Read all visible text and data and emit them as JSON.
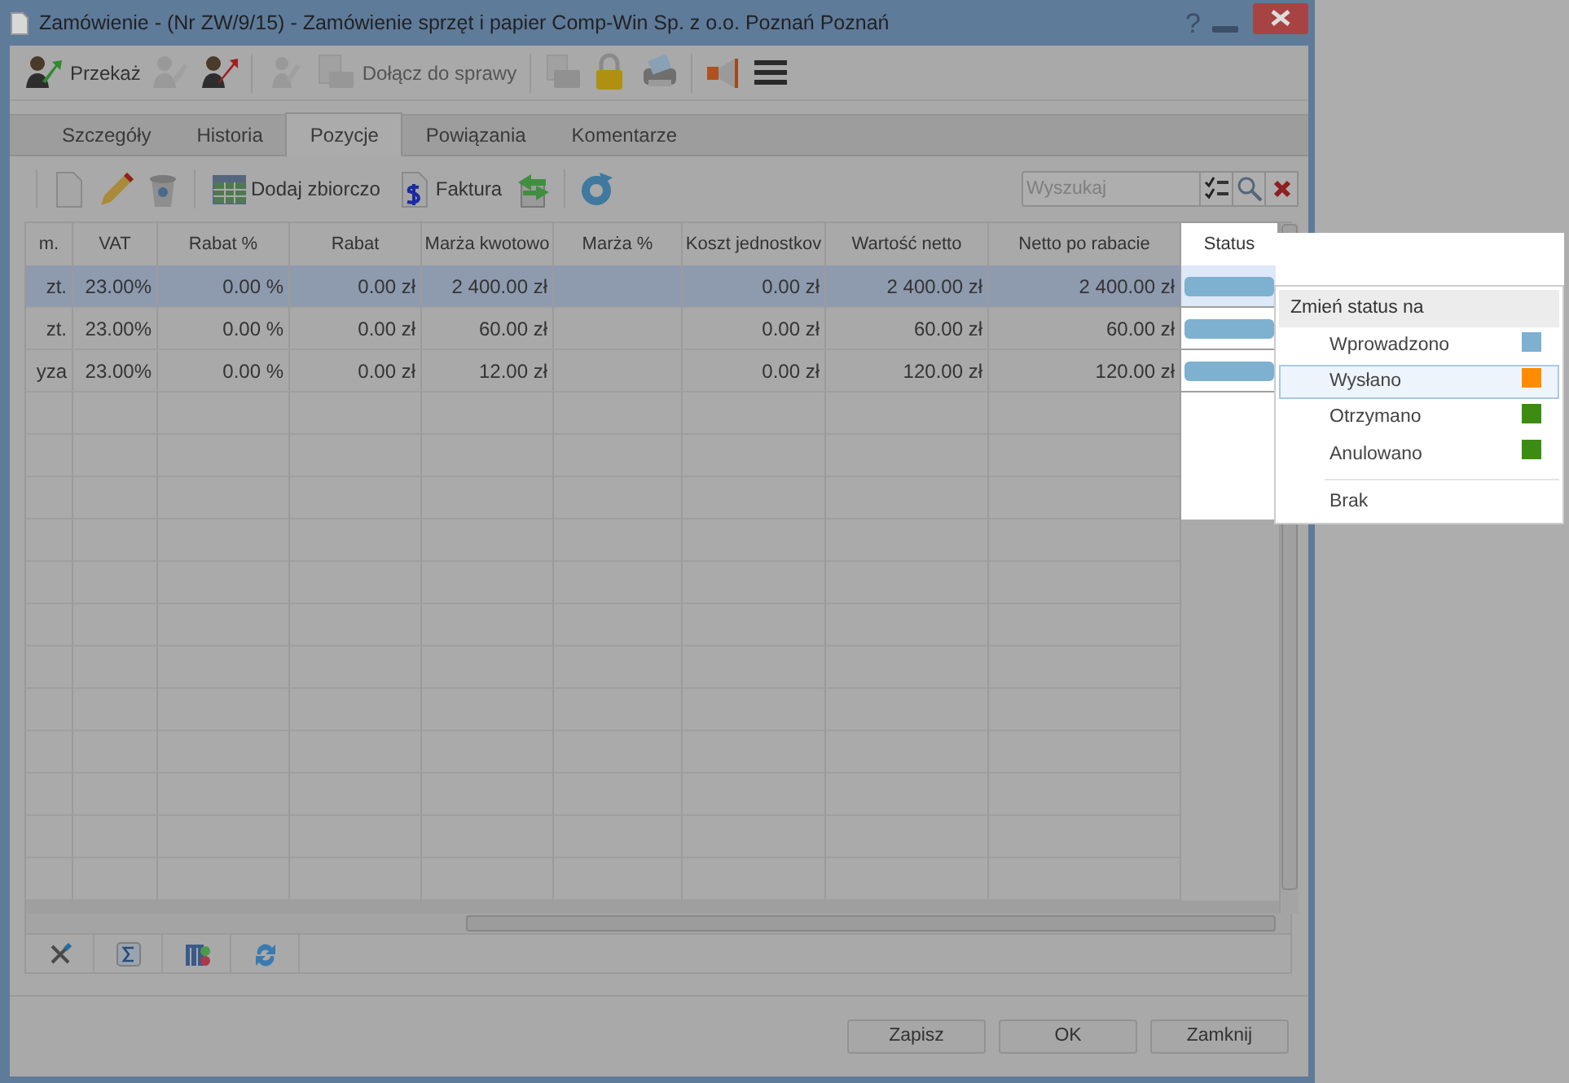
{
  "window": {
    "title": "Zamówienie - (Nr ZW/9/15) - Zamówienie sprzęt i papier Comp-Win Sp. z o.o. Poznań Poznań",
    "controls": [
      "?"
    ]
  },
  "toolbar": [
    {
      "kind": "forward",
      "label": "Przekaż",
      "disabled": false
    },
    {
      "kind": "person",
      "disabled": true
    },
    {
      "kind": "return",
      "disabled": false
    },
    {
      "kind": "people",
      "disabled": true
    },
    {
      "kind": "attach",
      "label": "Dołącz do sprawy",
      "disabled": true
    },
    {
      "kind": "folder",
      "disabled": true
    },
    {
      "kind": "lock",
      "disabled": false
    },
    {
      "kind": "print",
      "disabled": false
    },
    {
      "kind": "megaphone",
      "disabled": false
    },
    {
      "kind": "menu",
      "disabled": false
    }
  ],
  "tabs": [
    {
      "label": "Szczegóły",
      "selected": false
    },
    {
      "label": "Historia",
      "selected": false
    },
    {
      "label": "Pozycje",
      "selected": true
    },
    {
      "label": "Powiązania",
      "selected": false
    },
    {
      "label": "Komentarze",
      "selected": false
    }
  ],
  "grid_toolbar": [
    {
      "kind": "new"
    },
    {
      "kind": "edit"
    },
    {
      "kind": "delete"
    },
    {
      "kind": "table",
      "label": "Dodaj zbiorczo"
    },
    {
      "kind": "invoice",
      "label": "Faktura"
    },
    {
      "kind": "exchange"
    },
    {
      "kind": "refresh"
    }
  ],
  "search": {
    "placeholder": "Wyszukaj"
  },
  "table": {
    "columns": [
      "m.",
      "VAT",
      "Rabat %",
      "Rabat",
      "Marża kwotowo",
      "Marża %",
      "Koszt jednostkov",
      "Wartość netto",
      "Netto po rabacie",
      "Status"
    ],
    "rows": [
      {
        "selected": true,
        "cells": [
          "zt.",
          "23.00%",
          "0.00 %",
          "0.00 zł",
          "2 400.00 zł",
          null,
          "0.00 zł",
          "2 400.00 zł",
          "2 400.00 zł"
        ]
      },
      {
        "selected": false,
        "cells": [
          "zt.",
          "23.00%",
          "0.00 %",
          "0.00 zł",
          "60.00 zł",
          null,
          "0.00 zł",
          "60.00 zł",
          "60.00 zł"
        ]
      },
      {
        "selected": false,
        "cells": [
          "yza",
          "23.00%",
          "0.00 %",
          "0.00 zł",
          "12.00 zł",
          null,
          "0.00 zł",
          "120.00 zł",
          "120.00 zł"
        ]
      }
    ]
  },
  "context_menu": {
    "title": "Zmień status na",
    "items": [
      {
        "label": "Wprowadzono",
        "color": "#7eb0d0",
        "selected": false
      },
      {
        "label": "Wysłano",
        "color": "#ff8c00",
        "selected": true
      },
      {
        "label": "Otrzymano",
        "color": "#3c8c14",
        "selected": false
      },
      {
        "label": "Anulowano",
        "color": "#3c8c14",
        "selected": false
      },
      {
        "label": "Brak",
        "selected": false
      }
    ]
  },
  "buttons": [
    "Zapisz",
    "OK",
    "Zamknij"
  ]
}
